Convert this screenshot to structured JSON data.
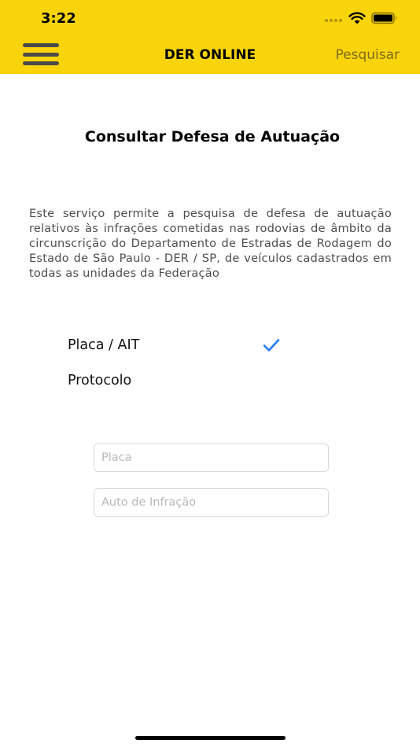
{
  "status_bar": {
    "time": "3:22"
  },
  "nav": {
    "title": "DER ONLINE",
    "search_label": "Pesquisar"
  },
  "page": {
    "title": "Consultar Defesa de Autuação",
    "description": "Este serviço permite a pesquisa de defesa de autuação relativos às infrações cometidas nas rodovias de âmbito da circunscrição do Departamento de Estradas de Rodagem do Estado de São Paulo - DER / SP, de veículos cadastrados em todas as unidades da Federação"
  },
  "options": [
    {
      "label": "Placa / AIT",
      "selected": true
    },
    {
      "label": "Protocolo",
      "selected": false
    }
  ],
  "form": {
    "plate_placeholder": "Placa",
    "infraction_placeholder": "Auto de Infração"
  },
  "colors": {
    "header": "#FAD40A",
    "accent": "#1F7BF4",
    "search_link": "#7D6A20"
  },
  "icons": {
    "menu": "hamburger-icon",
    "check": "checkmark-icon",
    "wifi": "wifi-icon",
    "battery": "battery-icon"
  }
}
